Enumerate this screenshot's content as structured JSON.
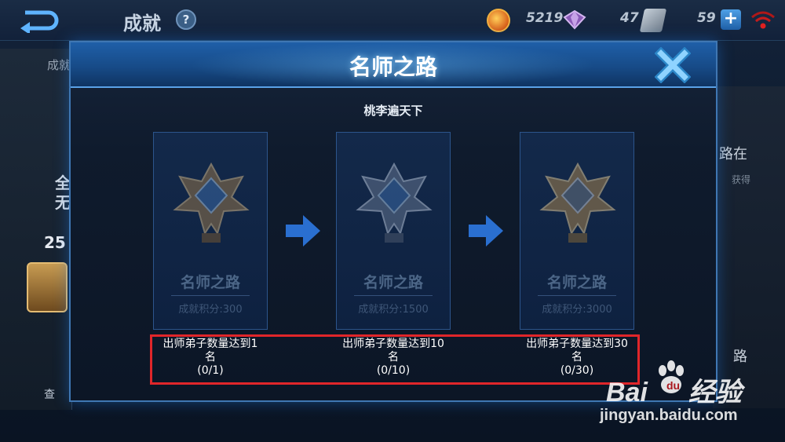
{
  "topbar": {
    "page_title": "成就",
    "help_glyph": "?",
    "resources": [
      {
        "icon": "coin-icon",
        "value": "5219"
      },
      {
        "icon": "gem-icon",
        "value": "47"
      },
      {
        "icon": "coupon-icon",
        "value": "59"
      }
    ],
    "plus_glyph": "+"
  },
  "background": {
    "left_label": "成就",
    "left_big_1": "全",
    "left_big_2": "无",
    "left_count": "25",
    "left_query": "查",
    "right_title": "路在",
    "right_sub": "获得",
    "right_title_2": "路"
  },
  "modal": {
    "title": "名师之路",
    "subtitle": "桃李遍天下",
    "cards": [
      {
        "name": "名师之路",
        "points": "成就积分:300",
        "emblem": "bronze-emblem-icon"
      },
      {
        "name": "名师之路",
        "points": "成就积分:1500",
        "emblem": "silver-emblem-icon"
      },
      {
        "name": "名师之路",
        "points": "成就积分:3000",
        "emblem": "gold-emblem-icon"
      }
    ],
    "requirements": [
      {
        "line1": "出师弟子数量达到1",
        "line2": "名",
        "progress": "(0/1)"
      },
      {
        "line1": "出师弟子数量达到10",
        "line2": "名",
        "progress": "(0/10)"
      },
      {
        "line1": "出师弟子数量达到30",
        "line2": "名",
        "progress": "(0/30)"
      }
    ]
  },
  "watermark": {
    "logo_left": "Bai",
    "logo_right": "经验",
    "url": "jingyan.baidu.com"
  },
  "colors": {
    "accent_blue": "#1f5fa8",
    "highlight_red": "#e0262a",
    "card_bg": "#13294a"
  }
}
